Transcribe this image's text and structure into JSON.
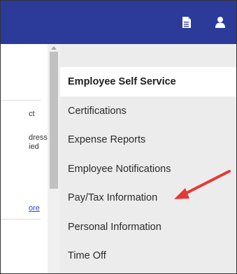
{
  "topbar": {
    "document_icon": "document-icon",
    "user_icon": "user-icon",
    "background": "#2c3a9a"
  },
  "left_pane": {
    "fragment_1": "ct",
    "fragment_2": "dress",
    "fragment_3": "ied",
    "link_fragment": "ore"
  },
  "menu": {
    "header": "Employee Self Service",
    "items": [
      "Certifications",
      "Expense Reports",
      "Employee Notifications",
      "Pay/Tax Information",
      "Personal Information",
      "Time Off"
    ]
  },
  "annotation": {
    "arrow_color": "#e53935",
    "points_to": "Pay/Tax Information"
  }
}
